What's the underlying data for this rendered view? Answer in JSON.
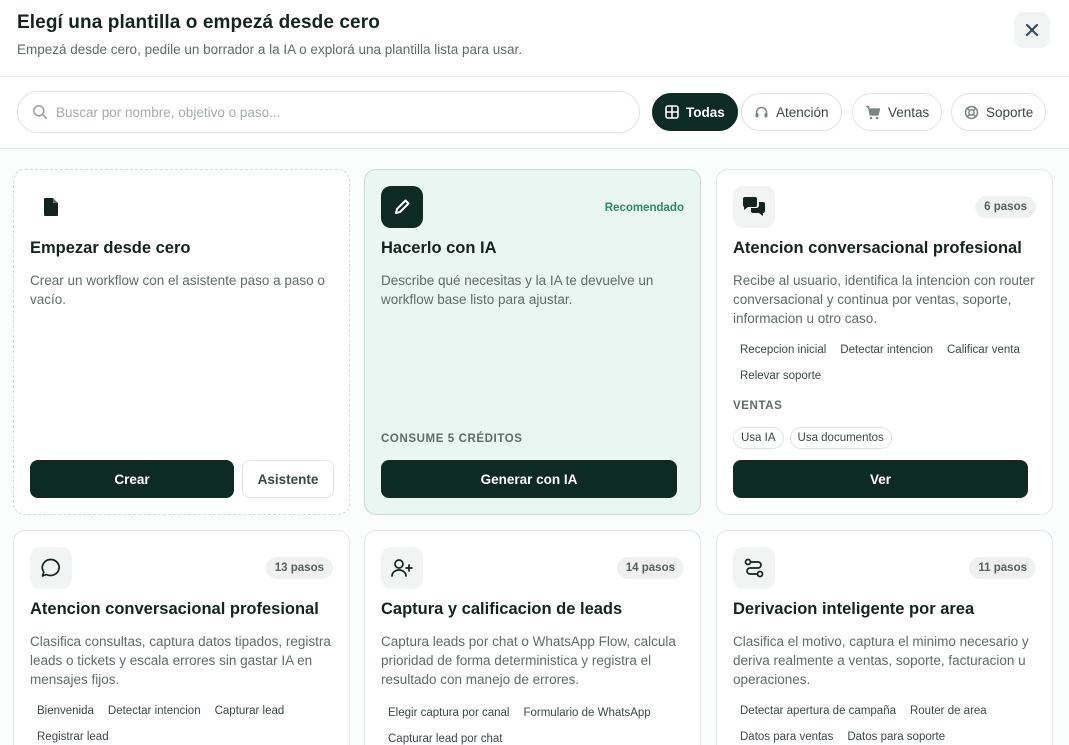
{
  "header": {
    "title": "Elegí una plantilla o empezá desde cero",
    "subtitle": "Empezá desde cero, pedile un borrador a la IA o explorá una plantilla lista para usar.",
    "close_icon": "close-icon"
  },
  "search": {
    "placeholder": "Buscar por nombre, objetivo o paso...",
    "value": ""
  },
  "filters": [
    {
      "label": "Todas",
      "icon": "grid-icon",
      "active": true
    },
    {
      "label": "Atención",
      "icon": "headset-icon",
      "active": false
    },
    {
      "label": "Ventas",
      "icon": "cart-icon",
      "active": false
    },
    {
      "label": "Soporte",
      "icon": "lifebuoy-icon",
      "active": false
    }
  ],
  "colors": {
    "primary": "#0d2b23",
    "featured_bg": "#eaf6f1",
    "recommended": "#2e8a66"
  },
  "cards": [
    {
      "title": "Empezar desde cero",
      "description": "Crear un workflow con el asistente paso a paso o vacío.",
      "icon": "file-icon",
      "primary_label": "Crear",
      "secondary_label": "Asistente"
    },
    {
      "title": "Hacerlo con IA",
      "description": "Describe qué necesitas y la IA te devuelve un workflow base listo para ajustar.",
      "icon": "pencil-icon",
      "badge": "Recomendado",
      "cost_label": "CONSUME 5 CRÉDITOS",
      "primary_label": "Generar con IA"
    },
    {
      "title": "Atencion conversacional profesional",
      "description": "Recibe al usuario, identifica la intencion con router conversacional y continua por ventas, soporte, informacion u otro caso.",
      "icon": "chat-bubbles-icon",
      "badge": "6 pasos",
      "steps": [
        "Recepcion inicial",
        "Detectar intencion",
        "Calificar venta",
        "Relevar soporte"
      ],
      "category": "VENTAS",
      "features": [
        "Usa IA",
        "Usa documentos"
      ],
      "primary_label": "Ver"
    },
    {
      "title": "Atencion conversacional profesional",
      "description": "Clasifica consultas, captura datos tipados, registra leads o tickets y escala errores sin gastar IA en mensajes fijos.",
      "icon": "message-circle-icon",
      "badge": "13 pasos",
      "steps": [
        "Bienvenida",
        "Detectar intencion",
        "Capturar lead",
        "Registrar lead"
      ]
    },
    {
      "title": "Captura y calificacion de leads",
      "description": "Captura leads por chat o WhatsApp Flow, calcula prioridad de forma deterministica y registra el resultado con manejo de errores.",
      "icon": "user-plus-icon",
      "badge": "14 pasos",
      "steps": [
        "Elegir captura por canal",
        "Formulario de WhatsApp",
        "Capturar lead por chat"
      ]
    },
    {
      "title": "Derivacion inteligente por area",
      "description": "Clasifica el motivo, captura el minimo necesario y deriva realmente a ventas, soporte, facturacion u operaciones.",
      "icon": "route-icon",
      "badge": "11 pasos",
      "steps": [
        "Detectar apertura de campaña",
        "Router de area",
        "Datos para ventas",
        "Datos para soporte"
      ]
    }
  ]
}
